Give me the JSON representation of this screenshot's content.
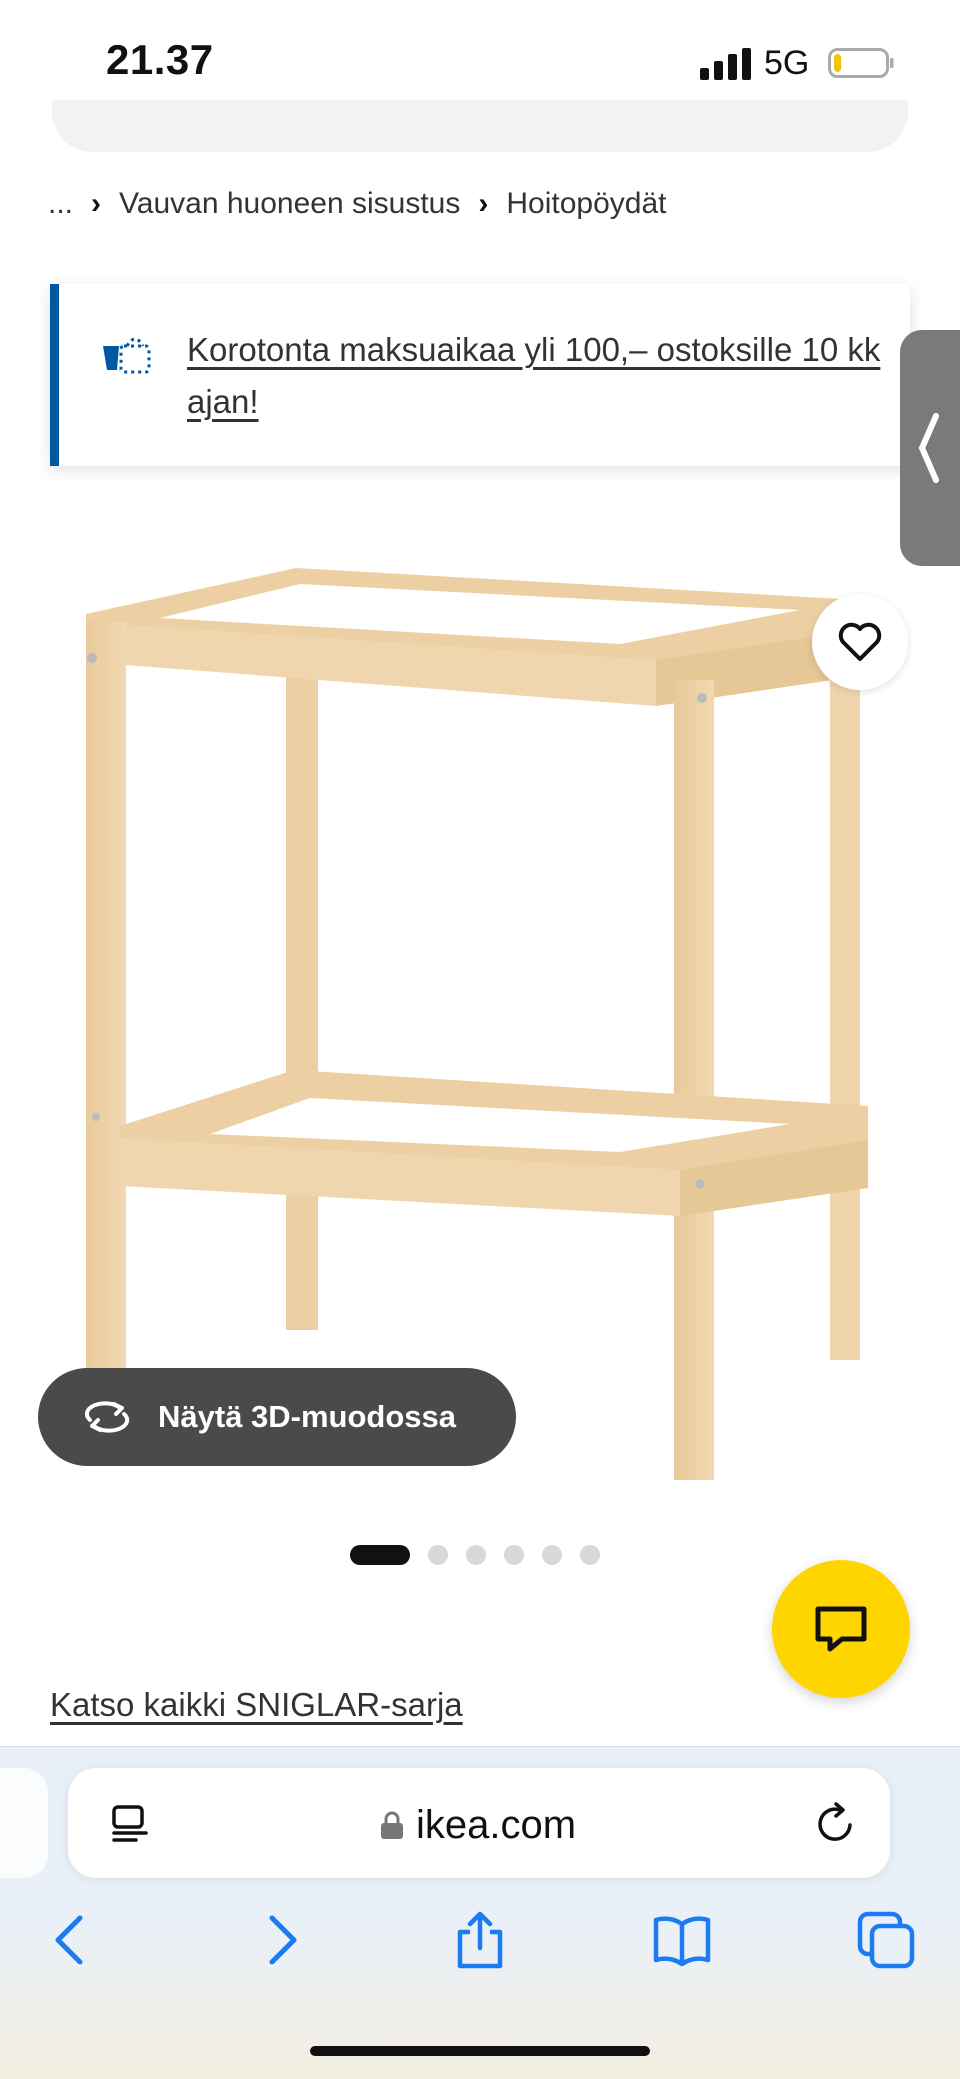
{
  "status_bar": {
    "time": "21.37",
    "network": "5G",
    "battery_level": 0.15
  },
  "breadcrumb": {
    "ellipsis": "...",
    "items": [
      "Vauvan huoneen sisustus",
      "Hoitopöydät"
    ]
  },
  "banner": {
    "text": "Korotonta maksuaikaa yli 100,– ostoksille 10 kk ajan!",
    "accent": "#0058a3"
  },
  "product": {
    "view_3d_label": "Näytä 3D-muodossa",
    "image_count": 6,
    "active_image": 1,
    "series_link": "Katso kaikki SNIGLAR-sarja"
  },
  "chat": {
    "color": "#ffd500"
  },
  "browser": {
    "url": "ikea.com",
    "icons": [
      "reader-icon",
      "lock-icon",
      "reload-icon",
      "back-icon",
      "forward-icon",
      "share-icon",
      "bookmarks-icon",
      "tabs-icon"
    ]
  }
}
